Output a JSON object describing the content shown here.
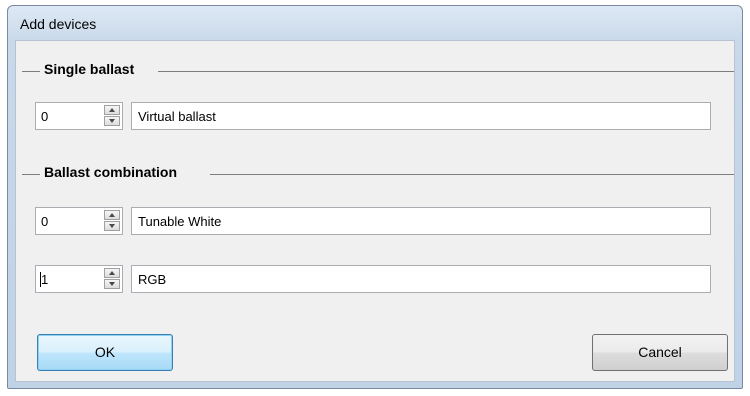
{
  "window": {
    "title": "Add devices"
  },
  "single_ballast": {
    "group_label": "Single ballast",
    "rows": [
      {
        "count": "0",
        "name": "Virtual ballast"
      }
    ]
  },
  "ballast_combination": {
    "group_label": "Ballast combination",
    "rows": [
      {
        "count": "0",
        "name": "Tunable White"
      },
      {
        "count": "1",
        "name": "RGB"
      }
    ]
  },
  "buttons": {
    "ok_label": "OK",
    "cancel_label": "Cancel"
  },
  "colors": {
    "title_bar": "#c9d9ea",
    "client_bg": "#f0f0f0",
    "default_button": "#3c7fb1"
  },
  "icons": {
    "spin_up": "triangle-up",
    "spin_down": "triangle-down"
  }
}
